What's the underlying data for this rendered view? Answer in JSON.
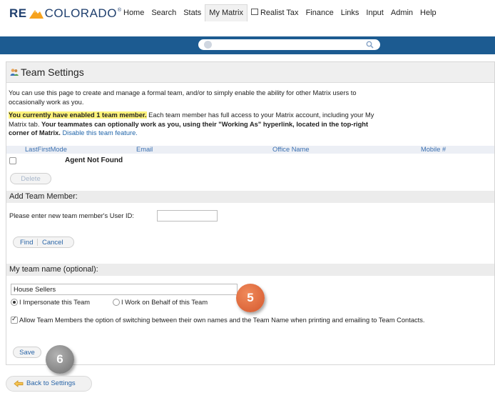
{
  "logo": {
    "left": "RE",
    "right": "COLORADO",
    "reg": "®"
  },
  "nav": {
    "items": [
      "Home",
      "Search",
      "Stats",
      "My Matrix",
      "Realist Tax",
      "Finance",
      "Links",
      "Input",
      "Admin",
      "Help"
    ],
    "active": "My Matrix"
  },
  "page": {
    "title": "Team Settings",
    "intro": "You can use this page to create and manage a formal team, and/or to simply enable the ability for other Matrix users to occasionally work as you.",
    "enabled_highlight": "You currently have enabled 1 team member.",
    "enabled_text_1": " Each team member has full access to your Matrix account, including your My Matrix tab. ",
    "enabled_bold": "Your teammates can optionally work as you, using their \"Working As\" hyperlink, located in the top-right corner of Matrix.",
    "disable_link": "Disable this team feature."
  },
  "table": {
    "headers": [
      "LastFirstMode",
      "Email",
      "Office Name",
      "Mobile #"
    ],
    "rows": [
      {
        "name": "Agent Not Found"
      }
    ],
    "delete_label": "Delete"
  },
  "add_member": {
    "heading": "Add Team Member:",
    "prompt": "Please enter new team member's User ID:",
    "user_id_value": "",
    "find_label": "Find",
    "cancel_label": "Cancel"
  },
  "team_name": {
    "heading": "My team name (optional):",
    "value": "House Sellers",
    "radio_impersonate": "I Impersonate this Team",
    "radio_behalf": "I Work on Behalf of this Team",
    "allow_label": "Allow Team Members the option of switching between their own names and the Team Name when printing and emailing to Team Contacts.",
    "save_label": "Save"
  },
  "callouts": {
    "five": "5",
    "six": "6"
  },
  "back_label": "Back to Settings",
  "colors": {
    "bluebar": "#1c5b91",
    "link": "#2266aa",
    "highlight": "#fff37a",
    "badge5": "#d4582e",
    "badge6": "#6f6f6f"
  }
}
